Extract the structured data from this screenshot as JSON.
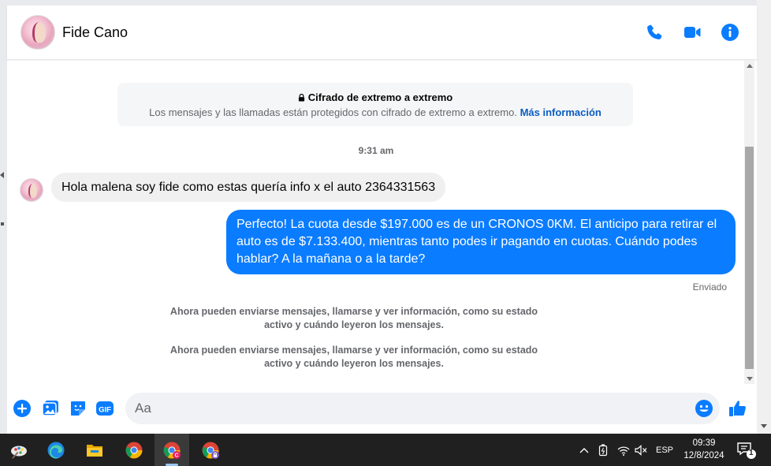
{
  "header": {
    "contact_name": "Fide Cano"
  },
  "encryption": {
    "title": "Cifrado de extremo a extremo",
    "description": "Los mensajes y las llamadas están protegidos con cifrado de extremo a extremo.",
    "link": "Más información"
  },
  "conversation": {
    "timestamp": "9:31 am",
    "incoming_message": "Hola malena soy fide como estas quería info x el auto 2364331563",
    "outgoing_message": "Perfecto! La cuota desde $197.000 es de un CRONOS 0KM. El anticipo para retirar el auto es de $7.133.400, mientras tanto podes ir pagando en cuotas. Cuándo podes hablar? A la mañana o a la tarde?",
    "sent_status": "Enviado",
    "system_messages": [
      "Ahora pueden enviarse mensajes, llamarse y ver información, como su estado activo y cuándo leyeron los mensajes.",
      "Ahora pueden enviarse mensajes, llamarse y ver información, como su estado activo y cuándo leyeron los mensajes."
    ]
  },
  "composer": {
    "placeholder": "Aa",
    "value": "",
    "gif_label": "GIF"
  },
  "taskbar": {
    "language": "ESP",
    "time": "09:39",
    "date": "12/8/2024",
    "notification_count": "1"
  },
  "icons": {
    "header": [
      "phone-icon",
      "video-camera-icon",
      "info-icon"
    ],
    "composer": [
      "plus-circle-icon",
      "gallery-icon",
      "sticker-icon",
      "gif-icon",
      "emoji-icon",
      "thumbs-up-icon"
    ],
    "taskbar_apps": [
      "paint-icon",
      "edge-icon",
      "file-explorer-icon",
      "chrome-icon",
      "chrome-profile-c-icon",
      "chrome-profile-lock-icon"
    ],
    "tray": [
      "chevron-up-icon",
      "battery-icon",
      "wifi-icon",
      "volume-muted-icon",
      "notification-icon"
    ]
  },
  "colors": {
    "accent": "#0a7cff",
    "outgoing_bubble": "#0a7cff",
    "incoming_bubble": "#f0f0f0",
    "link": "#0a5dc2",
    "taskbar": "#202020"
  }
}
